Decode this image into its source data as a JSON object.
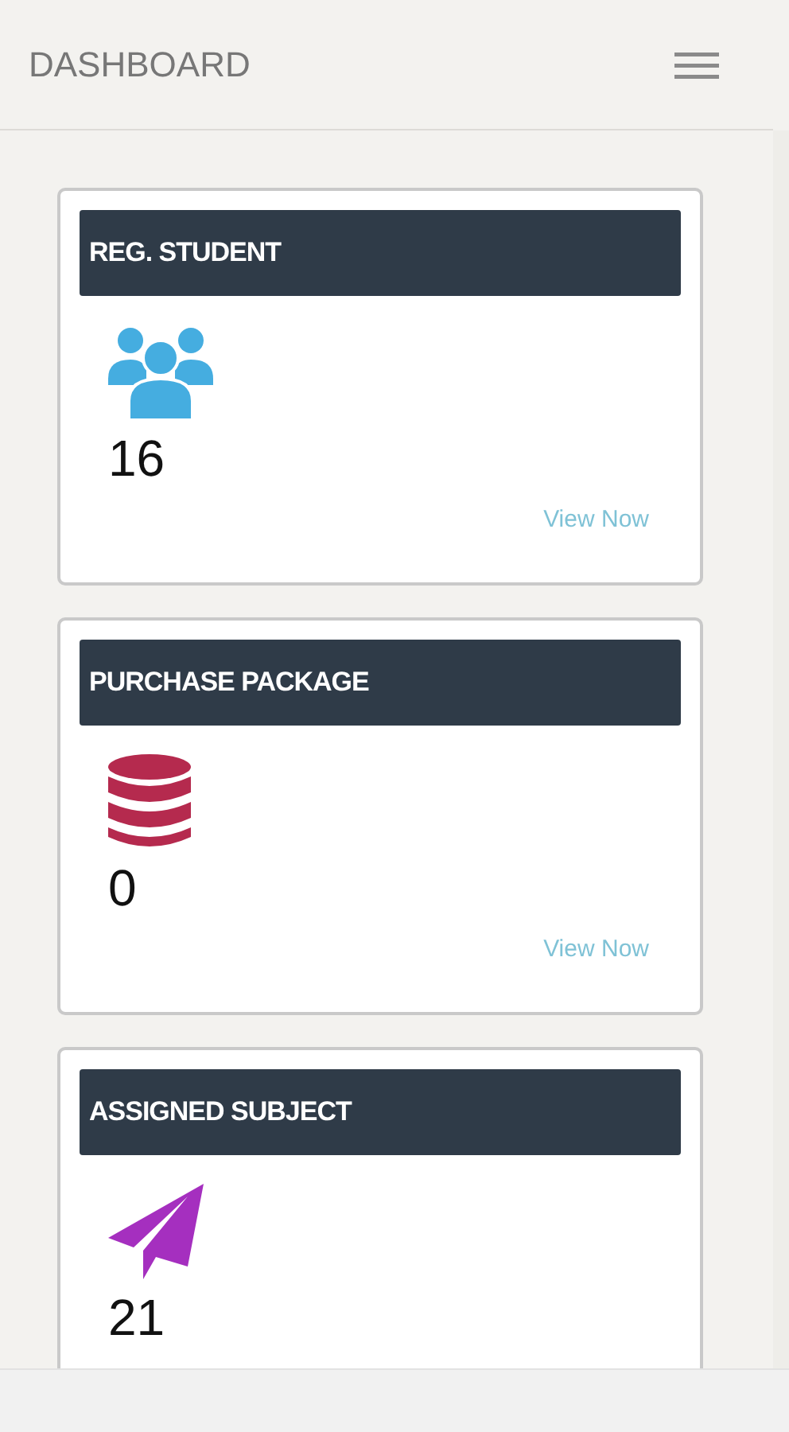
{
  "header": {
    "title": "DASHBOARD"
  },
  "cards": [
    {
      "title": "REG. STUDENT",
      "kind": "people",
      "color": "#45ade0",
      "count": "16",
      "link": "View Now"
    },
    {
      "title": "PURCHASE PACKAGE",
      "kind": "database",
      "color": "#b52a4e",
      "count": "0",
      "link": "View Now"
    },
    {
      "title": "ASSIGNED SUBJECT",
      "kind": "plane",
      "color": "#a52fbf",
      "count": "21"
    }
  ]
}
